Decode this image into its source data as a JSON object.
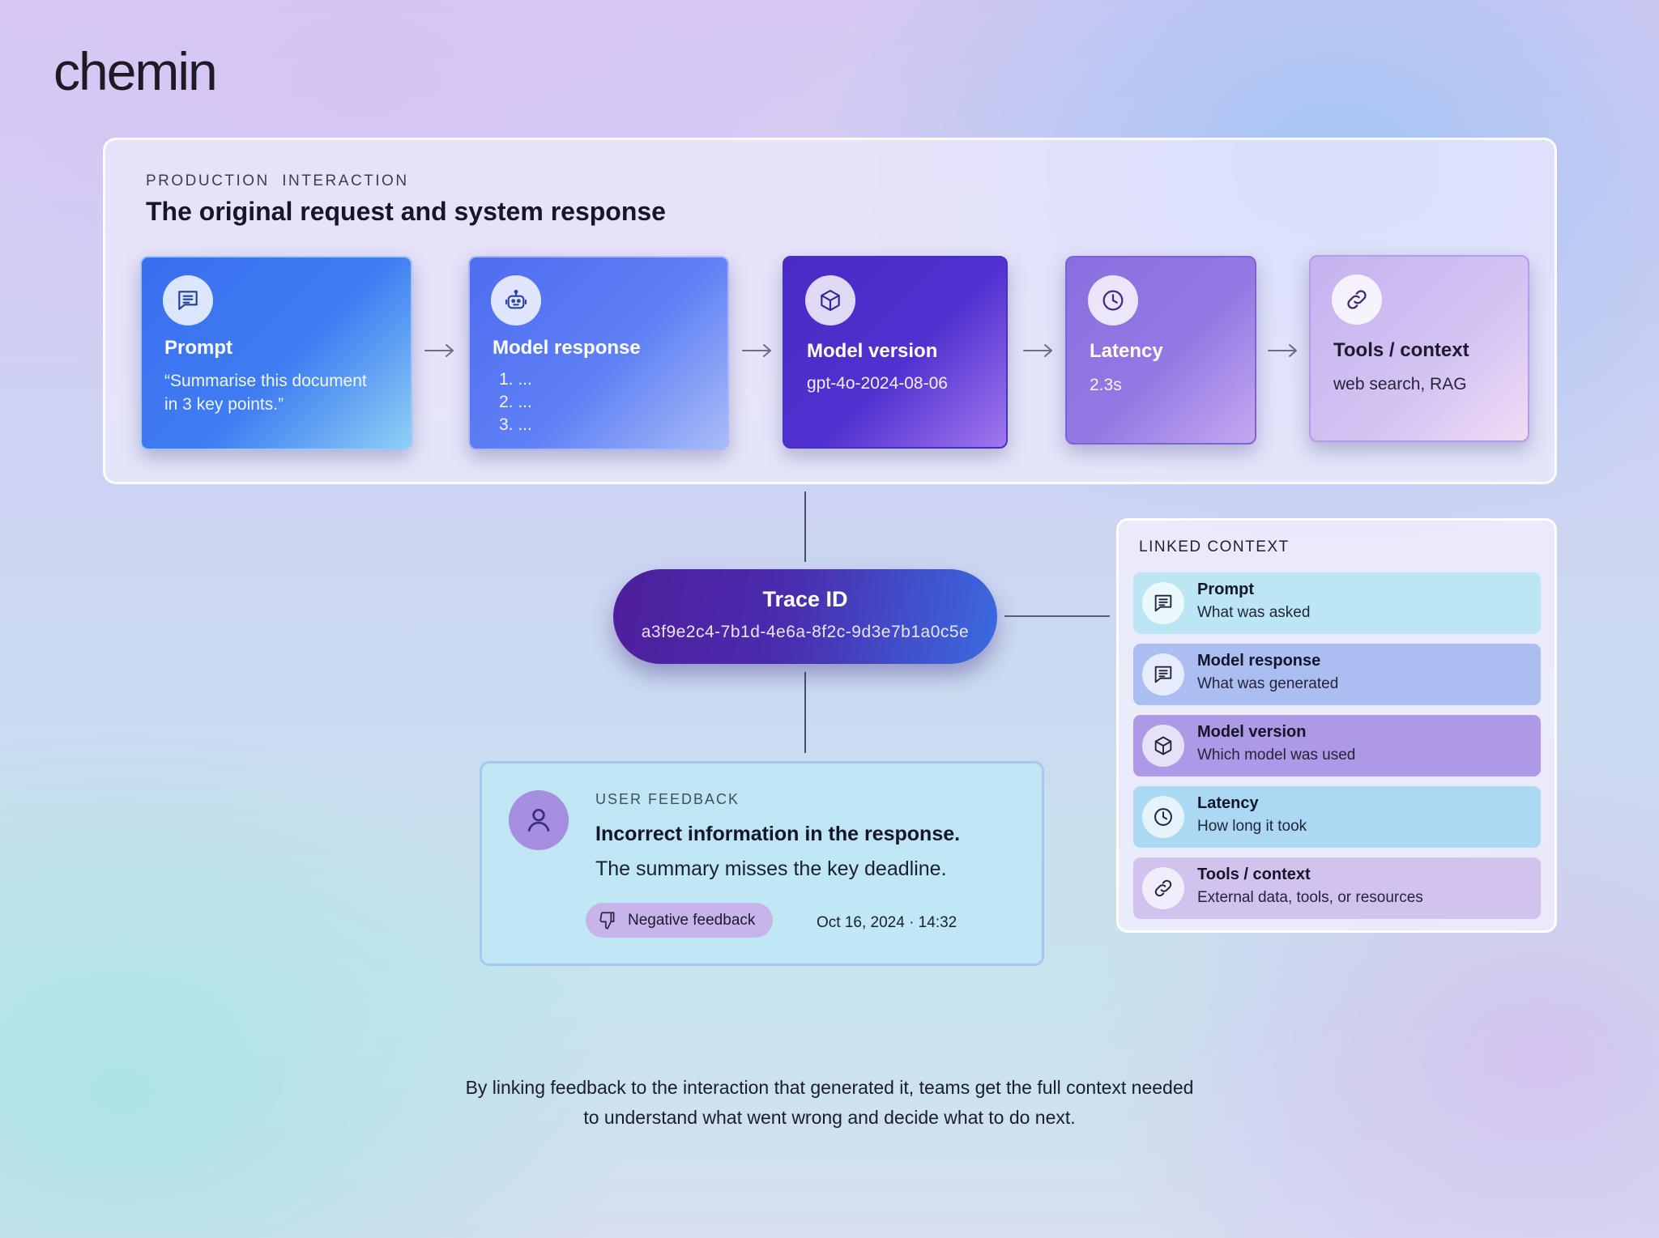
{
  "brand": {
    "logo": "chemin"
  },
  "production": {
    "kicker": "PRODUCTION  INTERACTION",
    "title": "The original request and system response",
    "steps": [
      {
        "icon": "chat-icon",
        "title": "Prompt",
        "body_lines": [
          "“Summarise this document",
          "in 3 key points.”"
        ]
      },
      {
        "icon": "robot-icon",
        "title": "Model response",
        "body_lines": [
          "1. ...",
          "2. ...",
          "3. ..."
        ]
      },
      {
        "icon": "cube-icon",
        "title": "Model version",
        "body_lines": [
          "gpt-4o-2024-08-06"
        ]
      },
      {
        "icon": "clock-icon",
        "title": "Latency",
        "body_lines": [
          "2.3s"
        ]
      },
      {
        "icon": "link-icon",
        "title": "Tools / context",
        "body_lines": [
          "web search, RAG"
        ]
      }
    ]
  },
  "trace": {
    "title": "Trace ID",
    "id": "a3f9e2c4-7b1d-4e6a-8f2c-9d3e7b1a0c5e"
  },
  "feedback": {
    "kicker": "USER FEEDBACK",
    "title": "Incorrect information in the response.",
    "body": "The summary misses the key deadline.",
    "chip_label": "Negative feedback",
    "chip_icon": "thumbs-down-icon",
    "timestamp": "Oct 16, 2024 · 14:32",
    "avatar_icon": "user-icon"
  },
  "linked_context": {
    "kicker": "LINKED CONTEXT",
    "items": [
      {
        "icon": "chat-icon",
        "title": "Prompt",
        "desc": "What was asked",
        "color": "#bde6f4"
      },
      {
        "icon": "chat-icon",
        "title": "Model response",
        "desc": "What was generated",
        "color": "#abbef2"
      },
      {
        "icon": "cube-icon",
        "title": "Model version",
        "desc": "Which model was used",
        "color": "#ad99e6"
      },
      {
        "icon": "clock-icon",
        "title": "Latency",
        "desc": "How long it took",
        "color": "#abd8f2"
      },
      {
        "icon": "link-icon",
        "title": "Tools / context",
        "desc": "External data, tools, or resources",
        "color": "#d2c2ee"
      }
    ]
  },
  "caption": {
    "line1": "By linking feedback to the interaction that generated it, teams get the full context needed",
    "line2": "to understand what went wrong and decide what to do next."
  }
}
